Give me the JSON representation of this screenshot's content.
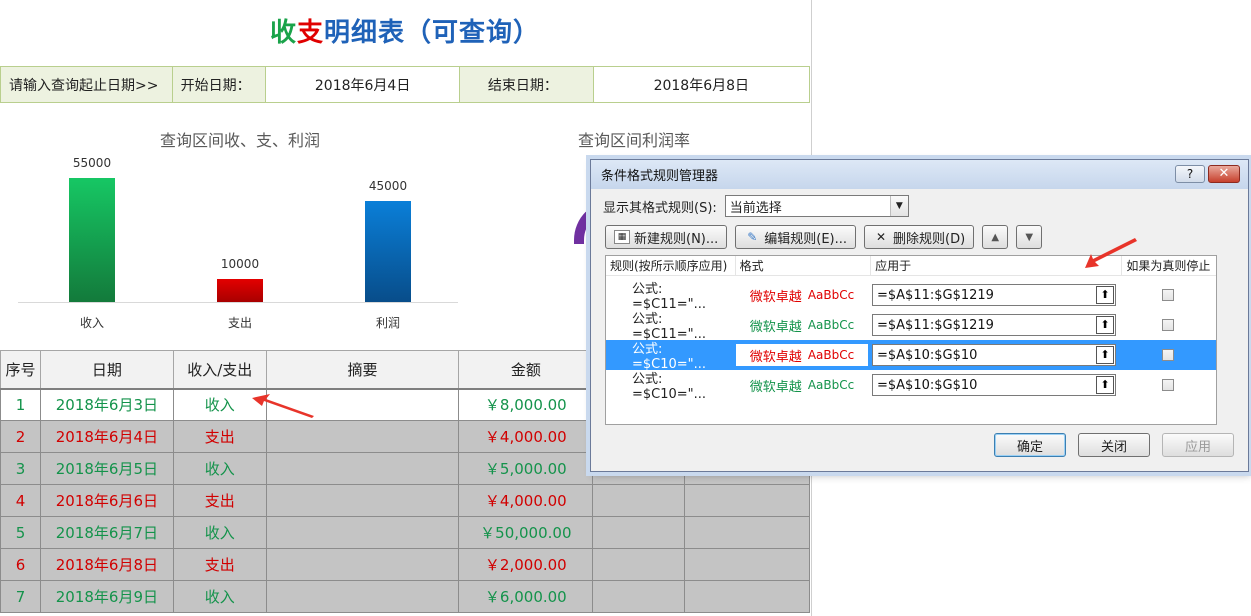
{
  "sheet": {
    "title_part1": "收",
    "title_part2": "支",
    "title_part3": "明细表（可查询）",
    "query_prompt": "请输入查询起止日期>>",
    "start_label": "开始日期：",
    "start_value": "2018年6月4日",
    "end_label": "结束日期：",
    "end_value": "2018年6月8日"
  },
  "chart1": {
    "title": "查询区间收、支、利润"
  },
  "chart2": {
    "title": "查询区间利润率"
  },
  "chart_data": {
    "type": "bar",
    "title": "查询区间收、支、利润",
    "categories": [
      "收入",
      "支出",
      "利润"
    ],
    "values": [
      55000,
      10000,
      45000
    ],
    "data_labels": [
      "55000",
      "10000",
      "45000"
    ],
    "colors": [
      "#1fa650",
      "#c00000",
      "#1464b4"
    ],
    "ylim": [
      0,
      60000
    ]
  },
  "table": {
    "headers": [
      "序号",
      "日期",
      "收入/支出",
      "摘要",
      "金额",
      "",
      ""
    ],
    "rows": [
      {
        "no": "1",
        "date": "2018年6月3日",
        "type": "收入",
        "summary": "",
        "amount": "￥8,000.00",
        "kind": "inc"
      },
      {
        "no": "2",
        "date": "2018年6月4日",
        "type": "支出",
        "summary": "",
        "amount": "￥4,000.00",
        "kind": "exp"
      },
      {
        "no": "3",
        "date": "2018年6月5日",
        "type": "收入",
        "summary": "",
        "amount": "￥5,000.00",
        "kind": "inc"
      },
      {
        "no": "4",
        "date": "2018年6月6日",
        "type": "支出",
        "summary": "",
        "amount": "￥4,000.00",
        "kind": "exp"
      },
      {
        "no": "5",
        "date": "2018年6月7日",
        "type": "收入",
        "summary": "",
        "amount": "￥50,000.00",
        "kind": "inc"
      },
      {
        "no": "6",
        "date": "2018年6月8日",
        "type": "支出",
        "summary": "",
        "amount": "￥2,000.00",
        "kind": "exp"
      },
      {
        "no": "7",
        "date": "2018年6月9日",
        "type": "收入",
        "summary": "",
        "amount": "￥6,000.00",
        "kind": "inc"
      }
    ]
  },
  "dialog": {
    "title": "条件格式规则管理器",
    "help_label": "?",
    "close_label": "✕",
    "show_label": "显示其格式规则(S):",
    "show_value": "当前选择",
    "new_rule": "新建规则(N)...",
    "edit_rule": "编辑规则(E)...",
    "delete_rule": "删除规则(D)",
    "col_rule": "规则(按所示顺序应用)",
    "col_format": "格式",
    "col_applies": "应用于",
    "col_stop": "如果为真则停止",
    "rules": [
      {
        "formula": "公式: =$C11=\"...",
        "preview": "微软卓越",
        "preview2": "AaBbCc",
        "applies": "=$A$11:$G$1219",
        "color": "red",
        "selected": false
      },
      {
        "formula": "公式: =$C11=\"...",
        "preview": "微软卓越",
        "preview2": "AaBbCc",
        "applies": "=$A$11:$G$1219",
        "color": "green",
        "selected": false
      },
      {
        "formula": "公式: =$C10=\"...",
        "preview": "微软卓越",
        "preview2": "AaBbCc",
        "applies": "=$A$10:$G$10",
        "color": "red",
        "selected": true
      },
      {
        "formula": "公式: =$C10=\"...",
        "preview": "微软卓越",
        "preview2": "AaBbCc",
        "applies": "=$A$10:$G$10",
        "color": "green",
        "selected": false
      }
    ],
    "ok": "确定",
    "close": "关闭",
    "apply": "应用"
  }
}
